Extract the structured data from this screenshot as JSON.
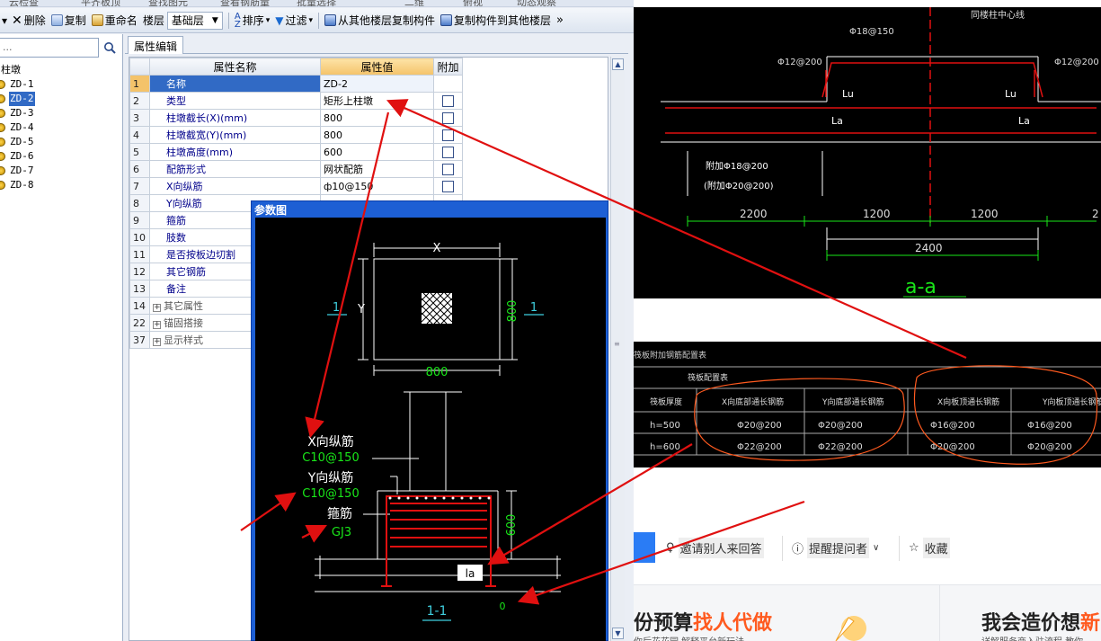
{
  "toolbar": {
    "delete": "删除",
    "copy": "复制",
    "rename": "重命名",
    "floor_label": "楼层",
    "floor_value": "基础层",
    "sort": "排序",
    "filter": "过滤",
    "copy_from": "从其他楼层复制构件",
    "copy_to": "复制构件到其他楼层",
    "more": "»",
    "top_cut": [
      "云检查",
      "平齐板顶",
      "查找图元",
      "查看钢筋量",
      "批量选择",
      "二维",
      "俯视",
      "动态观察"
    ]
  },
  "tree": {
    "search_placeholder": "...",
    "root": "柱墩",
    "items": [
      "ZD-1",
      "ZD-2",
      "ZD-3",
      "ZD-4",
      "ZD-5",
      "ZD-6",
      "ZD-7",
      "ZD-8"
    ],
    "selected": "ZD-2"
  },
  "panel": {
    "tab": "属性编辑"
  },
  "grid": {
    "headers": {
      "name": "属性名称",
      "value": "属性值",
      "extra": "附加"
    },
    "rows": [
      {
        "no": "1",
        "name": "名称",
        "value": "ZD-2",
        "checkbox": false
      },
      {
        "no": "2",
        "name": "类型",
        "value": "矩形上柱墩",
        "checkbox": true
      },
      {
        "no": "3",
        "name": "柱墩截长(X)(mm)",
        "value": "800",
        "checkbox": true
      },
      {
        "no": "4",
        "name": "柱墩截宽(Y)(mm)",
        "value": "800",
        "checkbox": true
      },
      {
        "no": "5",
        "name": "柱墩高度(mm)",
        "value": "600",
        "checkbox": true
      },
      {
        "no": "6",
        "name": "配筋形式",
        "value": "网状配筋",
        "checkbox": true
      },
      {
        "no": "7",
        "name": "X向纵筋",
        "value": "ф10@150",
        "checkbox": true
      },
      {
        "no": "8",
        "name": "Y向纵筋",
        "value": "",
        "checkbox": false
      },
      {
        "no": "9",
        "name": "箍筋",
        "value": "",
        "checkbox": false
      },
      {
        "no": "10",
        "name": "肢数",
        "value": "",
        "checkbox": false
      },
      {
        "no": "11",
        "name": "是否按板边切割",
        "value": "",
        "checkbox": false
      },
      {
        "no": "12",
        "name": "其它钢筋",
        "value": "",
        "checkbox": false
      },
      {
        "no": "13",
        "name": "备注",
        "value": "",
        "checkbox": false
      },
      {
        "no": "14",
        "name": "其它属性",
        "value": "",
        "group": true
      },
      {
        "no": "22",
        "name": "锚固搭接",
        "value": "",
        "group": true
      },
      {
        "no": "37",
        "name": "显示样式",
        "value": "",
        "group": true
      }
    ]
  },
  "popup": {
    "title": "参数图",
    "plan": {
      "x": "X",
      "y": "Y",
      "width": "800",
      "height": "800",
      "section": "1"
    },
    "section": {
      "x_bar": "X向纵筋",
      "x_bar_val": "C10@150",
      "y_bar": "Y向纵筋",
      "y_bar_val": "C10@150",
      "stirrup": "箍筋",
      "stirrup_val": "GJ3",
      "height": "600",
      "la": "la",
      "zero": "0",
      "name": "1-1"
    }
  },
  "cad1": {
    "top_note": "同楼柱中心线",
    "rebar_top": "Φ18@150",
    "rebar_left": "Φ12@200",
    "rebar_right": "Φ12@200",
    "lu": "Lu",
    "la": "La",
    "add_bar1": "附加Φ18@200",
    "add_bar2": "(附加Φ20@200)",
    "dims": [
      "2200",
      "1200",
      "1200",
      "2"
    ],
    "total": "2400",
    "section": "a-a"
  },
  "cad2": {
    "title": "筏板附加钢筋配置表",
    "group": "筏板配置表",
    "headers": [
      "筏板厚度",
      "X向底部通长钢筋",
      "Y向底部通长钢筋",
      "X向板顶通长钢筋",
      "Y向板顶通长钢筋"
    ],
    "rows": [
      [
        "h=500",
        "Φ20@200",
        "Φ20@200",
        "Φ16@200",
        "Φ16@200"
      ],
      [
        "h=600",
        "Φ22@200",
        "Φ22@200",
        "Φ20@200",
        "Φ20@200"
      ]
    ]
  },
  "qa": {
    "invite": "邀请别人来回答",
    "remind": "提醒提问者",
    "collect": "收藏"
  },
  "footer": {
    "left_a": "份预算",
    "left_b": "找人代做",
    "left_sub": "你后花花园 解释平台新玩法",
    "right": "我会造价想",
    "right_accent": "新",
    "right_sub": "详解服务商入驻流程 教你"
  },
  "colors": {
    "accent": "#316ac5",
    "cad_green": "#19e619",
    "cad_cyan": "#3fd0e0",
    "annotation_red": "#e01010",
    "footer_orange": "#ff5a1f"
  }
}
